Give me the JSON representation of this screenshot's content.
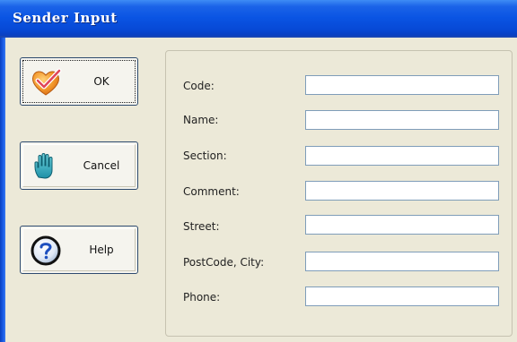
{
  "window": {
    "title": "Sender Input"
  },
  "buttons": [
    {
      "id": "ok",
      "label": "OK",
      "icon": "checkmark-heart-icon"
    },
    {
      "id": "cancel",
      "label": "Cancel",
      "icon": "hand-stop-icon"
    },
    {
      "id": "help",
      "label": "Help",
      "icon": "help-question-icon"
    }
  ],
  "fields": [
    {
      "label": "Code:",
      "value": ""
    },
    {
      "label": "Name:",
      "value": ""
    },
    {
      "label": "Section:",
      "value": ""
    },
    {
      "label": "Comment:",
      "value": ""
    },
    {
      "label": "Street:",
      "value": ""
    },
    {
      "label": "PostCode, City:",
      "value": ""
    },
    {
      "label": "Phone:",
      "value": ""
    }
  ],
  "colors": {
    "titlebar": "#0a54e3",
    "dialog_bg": "#ece9d8",
    "input_border": "#7f9db9",
    "button_border": "#2d4a6e"
  }
}
